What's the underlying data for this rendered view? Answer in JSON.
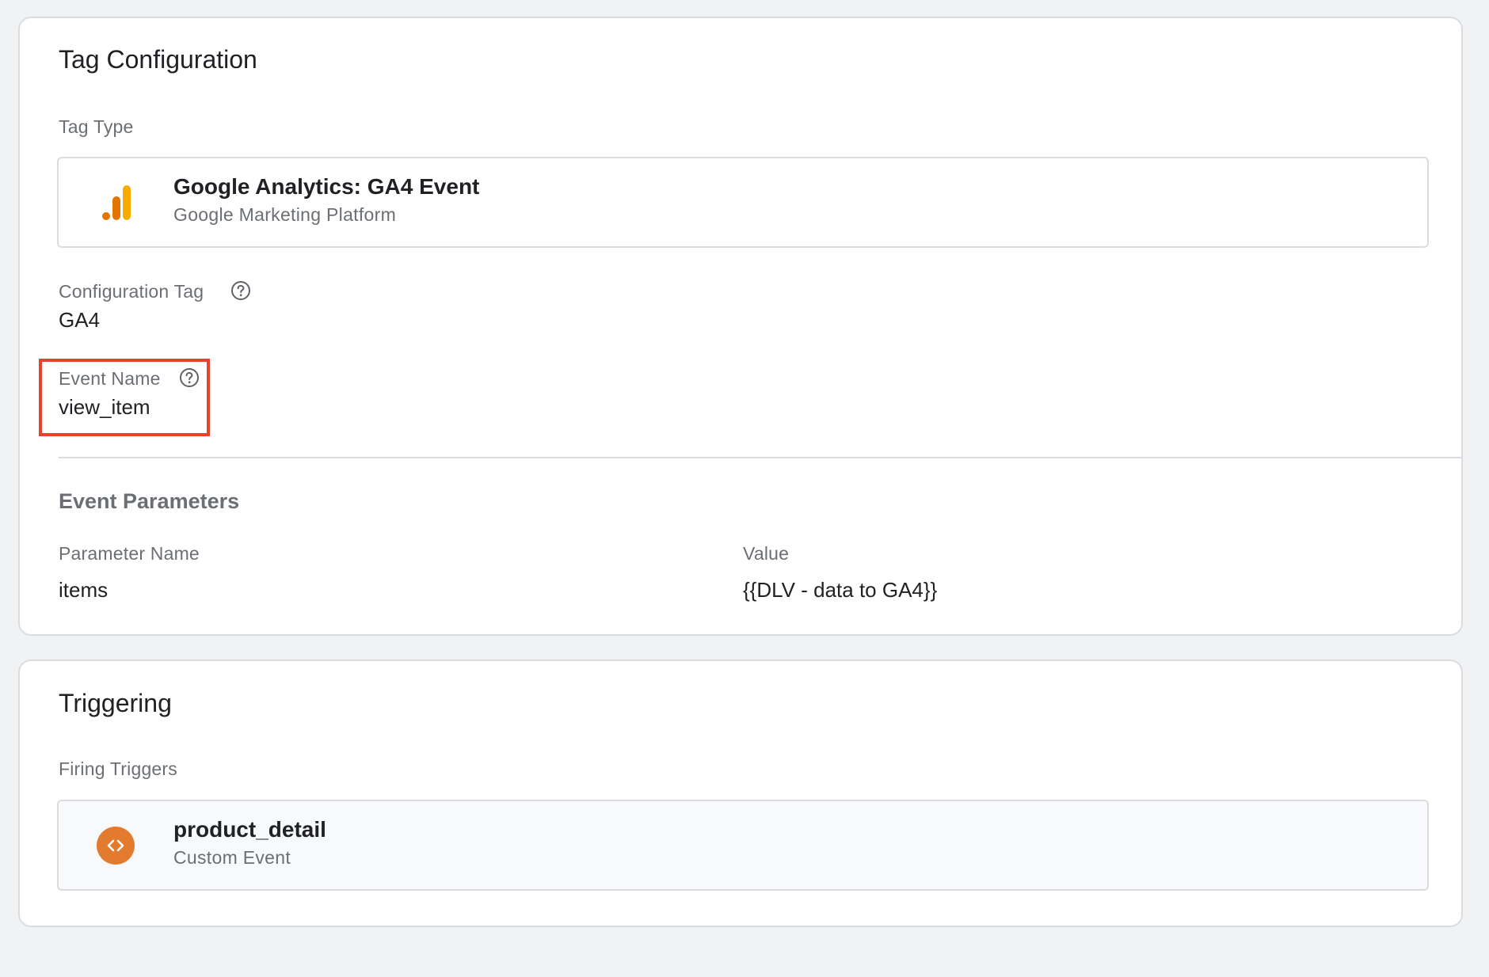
{
  "tag_configuration": {
    "title": "Tag Configuration",
    "tag_type_label": "Tag Type",
    "tag_type": {
      "name": "Google Analytics: GA4 Event",
      "provider": "Google Marketing Platform",
      "icon": "google-analytics-icon"
    },
    "configuration_tag": {
      "label": "Configuration Tag",
      "value": "GA4"
    },
    "event_name": {
      "label": "Event Name",
      "value": "view_item"
    },
    "event_parameters": {
      "heading": "Event Parameters",
      "columns": [
        "Parameter Name",
        "Value"
      ],
      "rows": [
        {
          "name": "items",
          "value": "{{DLV - data to GA4}}"
        }
      ]
    }
  },
  "triggering": {
    "title": "Triggering",
    "firing_triggers_label": "Firing Triggers",
    "trigger": {
      "name": "product_detail",
      "type": "Custom Event",
      "icon": "custom-event-icon"
    }
  },
  "colors": {
    "highlight": "#e8412c",
    "trigger_icon": "#e37b2f",
    "analytics_bar_light": "#f9ab00",
    "analytics_bar_dark": "#e37400"
  }
}
